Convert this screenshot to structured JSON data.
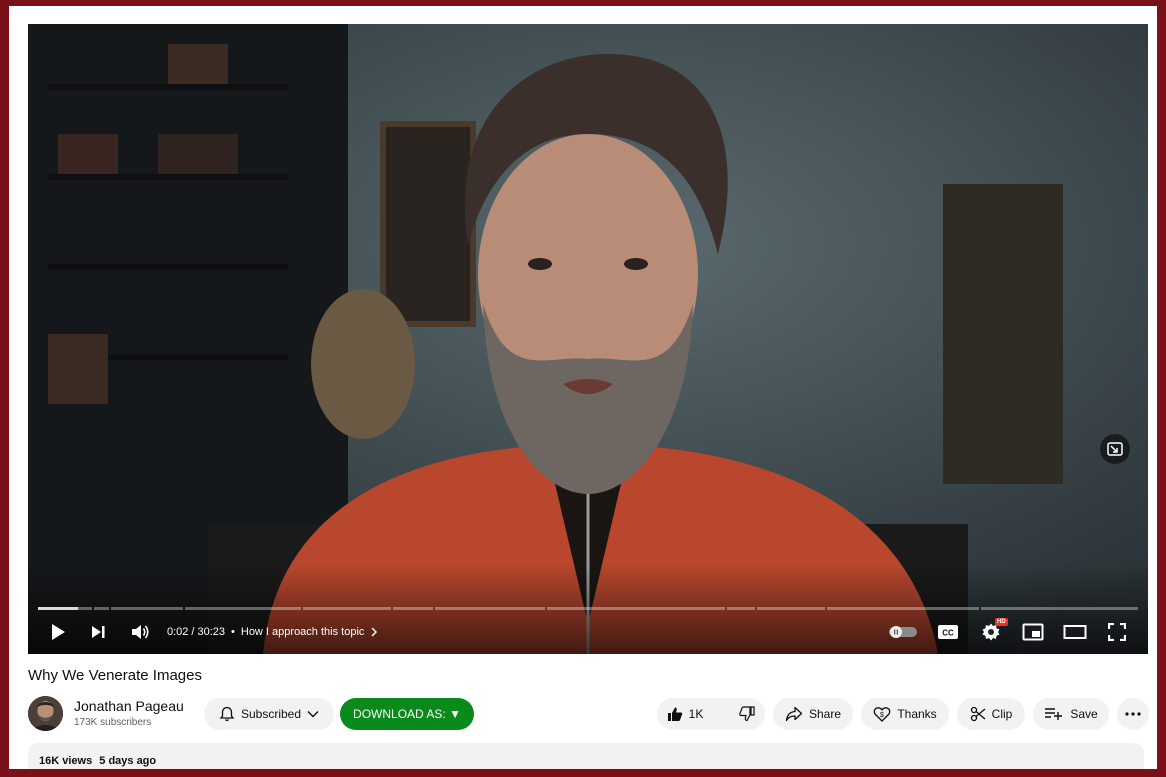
{
  "player": {
    "time_current": "0:02",
    "time_total": "30:23",
    "time_separator": "/",
    "chapter_label": "How I approach this topic",
    "hd_badge": "HD",
    "progress_fraction": 0.001
  },
  "icons": {
    "play": "play-icon",
    "next": "next-icon",
    "volume": "volume-icon",
    "autoplay": "autoplay-toggle-icon",
    "captions": "cc-icon",
    "settings": "gear-icon",
    "miniplayer": "miniplayer-icon",
    "theater": "theater-icon",
    "fullscreen": "fullscreen-icon"
  },
  "video": {
    "title": "Why We Venerate Images"
  },
  "channel": {
    "name": "Jonathan Pageau",
    "subscribers": "173K subscribers"
  },
  "actions": {
    "subscribed_label": "Subscribed",
    "download_label": "DOWNLOAD AS: ▼",
    "like_count": "1K",
    "share_label": "Share",
    "thanks_label": "Thanks",
    "clip_label": "Clip",
    "save_label": "Save"
  },
  "description": {
    "views": "16K views",
    "age": "5 days ago"
  },
  "colors": {
    "frame": "#7a1018",
    "download_green": "#0a8a1a",
    "pill_bg": "#f2f2f2"
  }
}
